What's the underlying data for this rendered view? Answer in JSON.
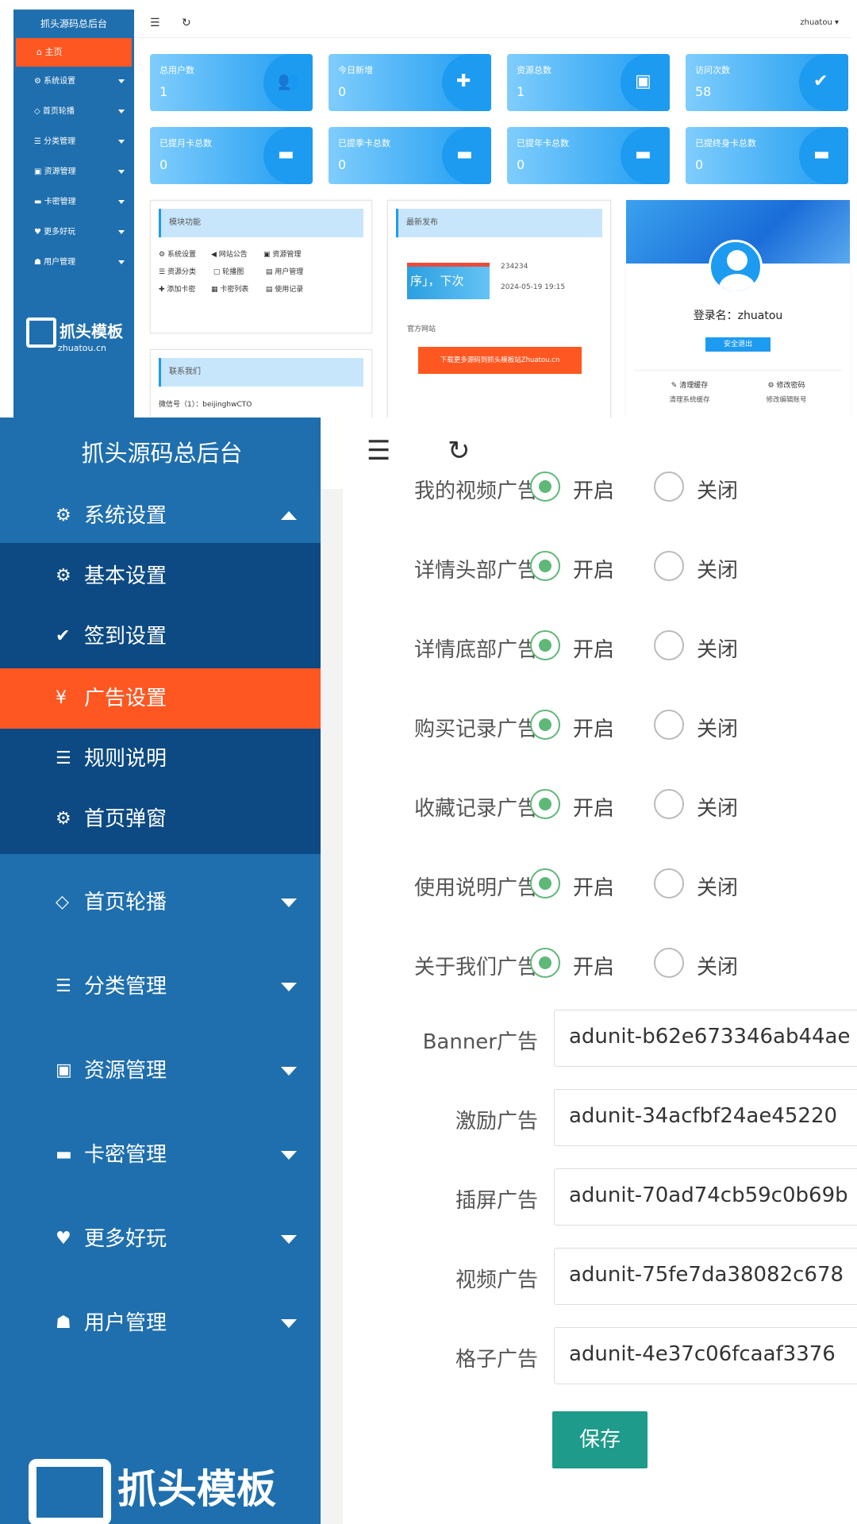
{
  "top": {
    "brand": "抓头源码总后台",
    "home": "主页",
    "menu": [
      "系统设置",
      "首页轮播",
      "分类管理",
      "资源管理",
      "卡密管理",
      "更多好玩",
      "用户管理"
    ],
    "logo": "抓头模板",
    "logo_sub": "zhuatou.cn",
    "user": "zhuatou",
    "stats": [
      {
        "label": "总用户数",
        "value": "1"
      },
      {
        "label": "今日新增",
        "value": "0"
      },
      {
        "label": "资源总数",
        "value": "1"
      },
      {
        "label": "访问次数",
        "value": "58"
      },
      {
        "label": "已提月卡总数",
        "value": "0"
      },
      {
        "label": "已提季卡总数",
        "value": "0"
      },
      {
        "label": "已提年卡总数",
        "value": "0"
      },
      {
        "label": "已提终身卡总数",
        "value": "0"
      }
    ],
    "modules_title": "模块功能",
    "modules": [
      "系统设置",
      "网站公告",
      "资源管理",
      "资源分类",
      "轮播图",
      "用户管理",
      "添加卡密",
      "卡密列表",
      "使用记录"
    ],
    "contact_title": "联系我们",
    "contact_line": "微信号（1）：beijinghwCTO",
    "news_title": "最新发布",
    "news_item": "234234",
    "news_date": "2024-05-19 19:15",
    "news_site": "官方网站",
    "news_btn": "下载更多源码到抓头模板站Zhuatou.cn",
    "profile_name": "登录名：zhuatou",
    "logout": "安全退出",
    "clear": "清理缓存",
    "clear_sub": "清理系统缓存",
    "pwd": "修改密码",
    "pwd_sub": "修改编辑账号"
  },
  "bottom": {
    "brand": "抓头源码总后台",
    "system": "系统设置",
    "sub_items": [
      "基本设置",
      "签到设置",
      "广告设置",
      "规则说明",
      "首页弹窗"
    ],
    "menu": [
      "首页轮播",
      "分类管理",
      "资源管理",
      "卡密管理",
      "更多好玩",
      "用户管理"
    ],
    "logo": "抓头模板",
    "on": "开启",
    "off": "关闭",
    "radio_rows": [
      "我的视频广告",
      "详情头部广告",
      "详情底部广告",
      "购买记录广告",
      "收藏记录广告",
      "使用说明广告",
      "关于我们广告"
    ],
    "inputs": [
      {
        "label": "Banner广告",
        "value": "adunit-b62e673346ab44ae"
      },
      {
        "label": "激励广告",
        "value": "adunit-34acfbf24ae45220"
      },
      {
        "label": "插屏广告",
        "value": "adunit-70ad74cb59c0b69b"
      },
      {
        "label": "视频广告",
        "value": "adunit-75fe7da38082c678"
      },
      {
        "label": "格子广告",
        "value": "adunit-4e37c06fcaaf3376"
      }
    ],
    "save": "保存"
  }
}
